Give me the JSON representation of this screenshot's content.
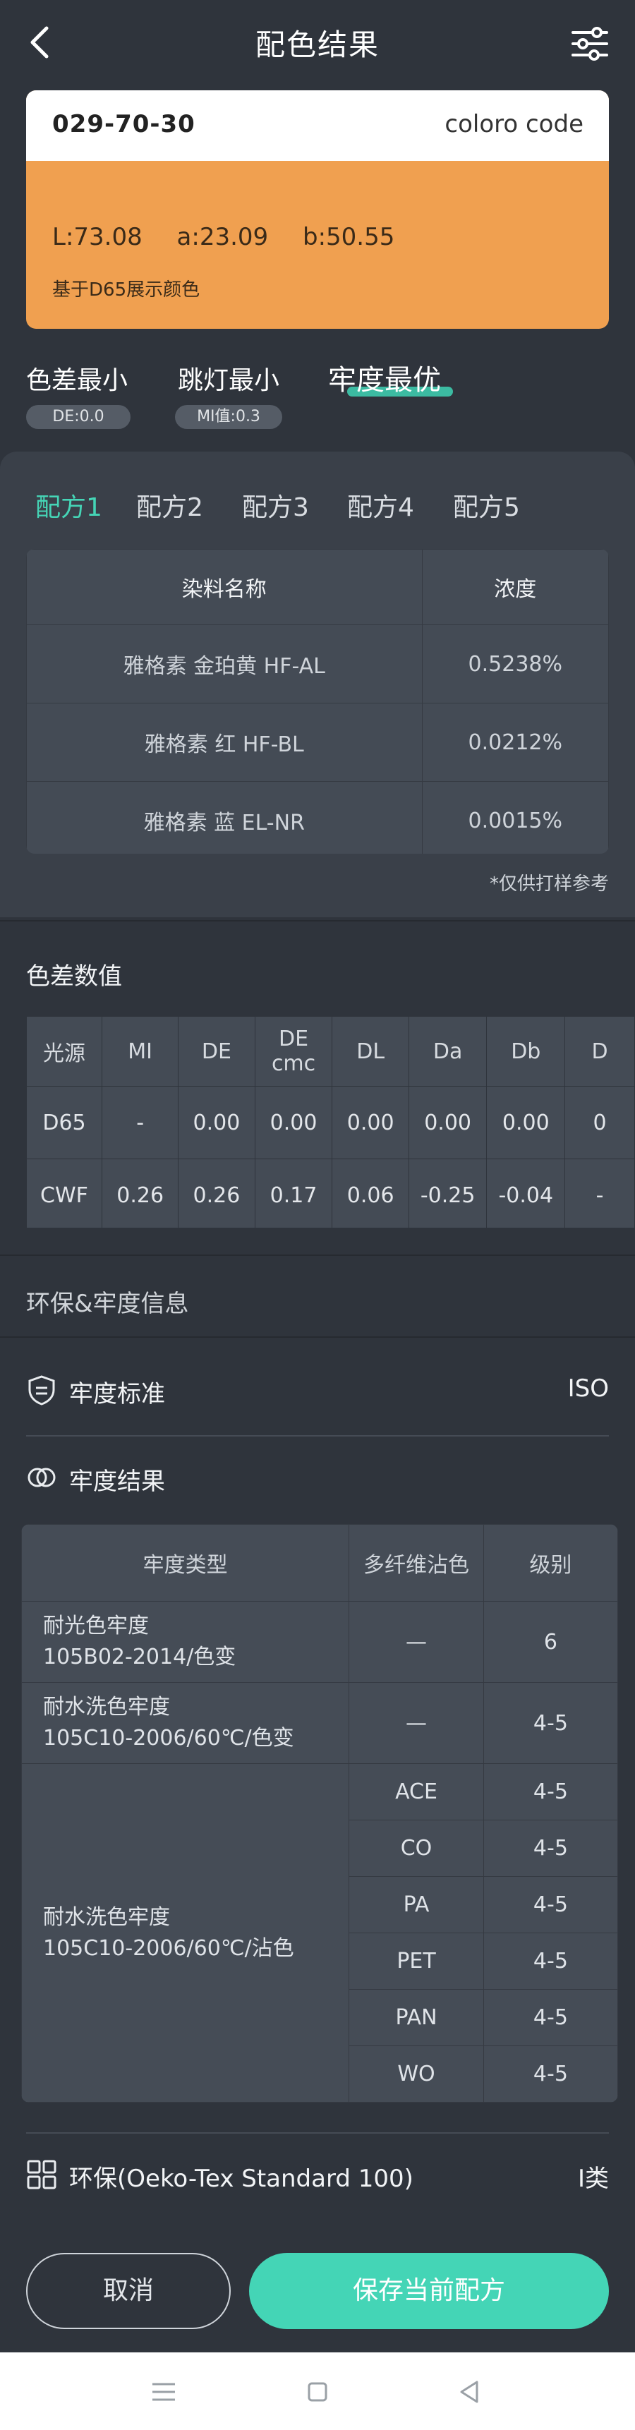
{
  "header": {
    "title": "配色结果",
    "back_icon": "back-arrow-icon",
    "settings_icon": "sliders-icon"
  },
  "color_card": {
    "code": "029-70-30",
    "brand": "coloro code",
    "L": "L:73.08",
    "a": "a:23.09",
    "b": "b:50.55",
    "note": "基于D65展示颜色",
    "swatch_color": "#f0a050"
  },
  "modes": [
    {
      "label": "色差最小",
      "badge": "DE:0.0"
    },
    {
      "label": "跳灯最小",
      "badge": "MI值:0.3"
    },
    {
      "label": "牢度最优"
    }
  ],
  "recipe_tabs": [
    "配方1",
    "配方2",
    "配方3",
    "配方4",
    "配方5"
  ],
  "recipe_table": {
    "headers": [
      "染料名称",
      "浓度"
    ],
    "rows": [
      [
        "雅格素 金珀黄 HF-AL",
        "0.5238%"
      ],
      [
        "雅格素 红 HF-BL",
        "0.0212%"
      ],
      [
        "雅格素 蓝 EL-NR",
        "0.0015%"
      ]
    ],
    "note": "*仅供打样参考"
  },
  "color_diff": {
    "title": "色差数值",
    "headers": [
      "光源",
      "MI",
      "DE",
      "DE cmc",
      "DL",
      "Da",
      "Db",
      "D"
    ],
    "rows": [
      [
        "D65",
        "-",
        "0.00",
        "0.00",
        "0.00",
        "0.00",
        "0.00",
        "0"
      ],
      [
        "CWF",
        "0.26",
        "0.26",
        "0.17",
        "0.06",
        "-0.25",
        "-0.04",
        "-"
      ]
    ]
  },
  "eco_section": {
    "title": "环保&牢度信息"
  },
  "fastness_standard": {
    "label": "牢度标准",
    "value": "ISO"
  },
  "fastness_result": {
    "label": "牢度结果",
    "headers": [
      "牢度类型",
      "多纤维沾色",
      "级别"
    ],
    "rows": [
      {
        "type_line1": "耐光色牢度",
        "type_line2": "105B02-2014/色变",
        "fiber": "—",
        "grade": "6"
      },
      {
        "type_line1": "耐水洗色牢度",
        "type_line2": "105C10-2006/60℃/色变",
        "fiber": "—",
        "grade": "4-5"
      }
    ],
    "staining": {
      "type_line1": "耐水洗色牢度",
      "type_line2": "105C10-2006/60℃/沾色",
      "rows": [
        {
          "fiber": "ACE",
          "grade": "4-5"
        },
        {
          "fiber": "CO",
          "grade": "4-5"
        },
        {
          "fiber": "PA",
          "grade": "4-5"
        },
        {
          "fiber": "PET",
          "grade": "4-5"
        },
        {
          "fiber": "PAN",
          "grade": "4-5"
        },
        {
          "fiber": "WO",
          "grade": "4-5"
        }
      ]
    }
  },
  "eco_standard": {
    "label": "环保(Oeko-Tex Standard 100)",
    "value": "I类"
  },
  "buttons": {
    "cancel": "取消",
    "save": "保存当前配方"
  },
  "colors": {
    "accent": "#44d5b6",
    "background": "#2f343c",
    "panel": "#3a4049"
  }
}
